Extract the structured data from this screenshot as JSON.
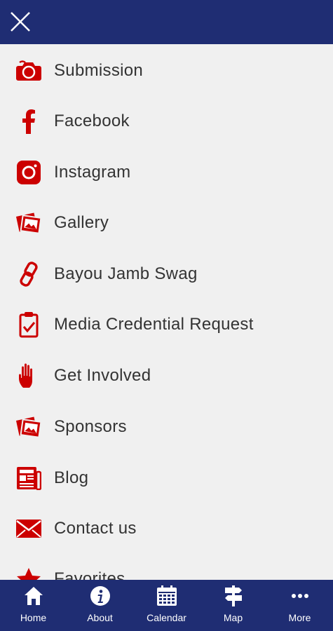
{
  "colors": {
    "header_bg": "#1f2d73",
    "accent": "#cc0000",
    "page_bg": "#f0f0f0",
    "text": "#333333"
  },
  "header": {
    "close_icon": "close-icon"
  },
  "menu": {
    "items": [
      {
        "label": "Submission",
        "icon": "camera-icon"
      },
      {
        "label": "Facebook",
        "icon": "facebook-icon"
      },
      {
        "label": "Instagram",
        "icon": "instagram-icon"
      },
      {
        "label": "Gallery",
        "icon": "photos-icon"
      },
      {
        "label": "Bayou Jamb Swag",
        "icon": "link-icon"
      },
      {
        "label": "Media Credential Request",
        "icon": "clipboard-icon"
      },
      {
        "label": "Get Involved",
        "icon": "hand-icon"
      },
      {
        "label": "Sponsors",
        "icon": "photos-icon"
      },
      {
        "label": "Blog",
        "icon": "newspaper-icon"
      },
      {
        "label": "Contact us",
        "icon": "envelope-icon"
      },
      {
        "label": "Favorites",
        "icon": "star-icon"
      }
    ]
  },
  "tabbar": {
    "tabs": [
      {
        "label": "Home",
        "icon": "home-icon"
      },
      {
        "label": "About",
        "icon": "info-icon"
      },
      {
        "label": "Calendar",
        "icon": "calendar-icon"
      },
      {
        "label": "Map",
        "icon": "signpost-icon"
      },
      {
        "label": "More",
        "icon": "more-icon"
      }
    ]
  }
}
